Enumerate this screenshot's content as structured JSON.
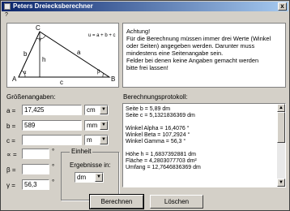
{
  "window": {
    "title": "Peters Dreiecksberechner",
    "close_label": "x"
  },
  "menu": {
    "item": "?"
  },
  "diagram": {
    "formula": "u = a + b + c",
    "labels": {
      "C": "C",
      "A": "A",
      "B": "B",
      "a": "a",
      "b": "b",
      "c": "c",
      "h": "h",
      "alpha": "α",
      "beta": "β",
      "gamma": "γ"
    }
  },
  "notice": {
    "lines": [
      "Achtung!",
      "Für die Berechnung müssen immer drei Werte (Winkel",
      "oder Seiten) angegeben werden. Darunter muss",
      "mindestens eine Seitenangabe sein.",
      "Felder bei denen keine Angaben gemacht werden",
      "bitte frei lassen!"
    ]
  },
  "inputs": {
    "heading": "Größenangaben:",
    "sides": [
      {
        "label": "a =",
        "value": "17,425",
        "unit": "cm"
      },
      {
        "label": "b =",
        "value": "589",
        "unit": "mm"
      },
      {
        "label": "c =",
        "value": "",
        "unit": "m"
      }
    ],
    "angles": [
      {
        "label": "∝ =",
        "value": "",
        "unit": "°"
      },
      {
        "label": "β =",
        "value": "",
        "unit": "°"
      },
      {
        "label": "γ =",
        "value": "56,3",
        "unit": "°"
      }
    ]
  },
  "unit_group": {
    "title": "Einheit",
    "caption": "Ergebnisse in:",
    "value": "dm"
  },
  "protocol": {
    "heading": "Berechnungsprotokoll:",
    "lines": [
      "Seite b = 5,89 dm",
      "Seite c = 5,1321836369 dm",
      "",
      "Winkel Alpha = 16,4076 °",
      "Winkel Beta = 107,2924 °",
      "Winkel Gamma = 56,3 °",
      "",
      "Höhe h = 1,6837392881 dm",
      "Fläche = 4,2803077703 dm²",
      "Umfang = 12,7646836369 dm"
    ]
  },
  "buttons": {
    "compute": "Berechnen",
    "clear": "Löschen"
  }
}
